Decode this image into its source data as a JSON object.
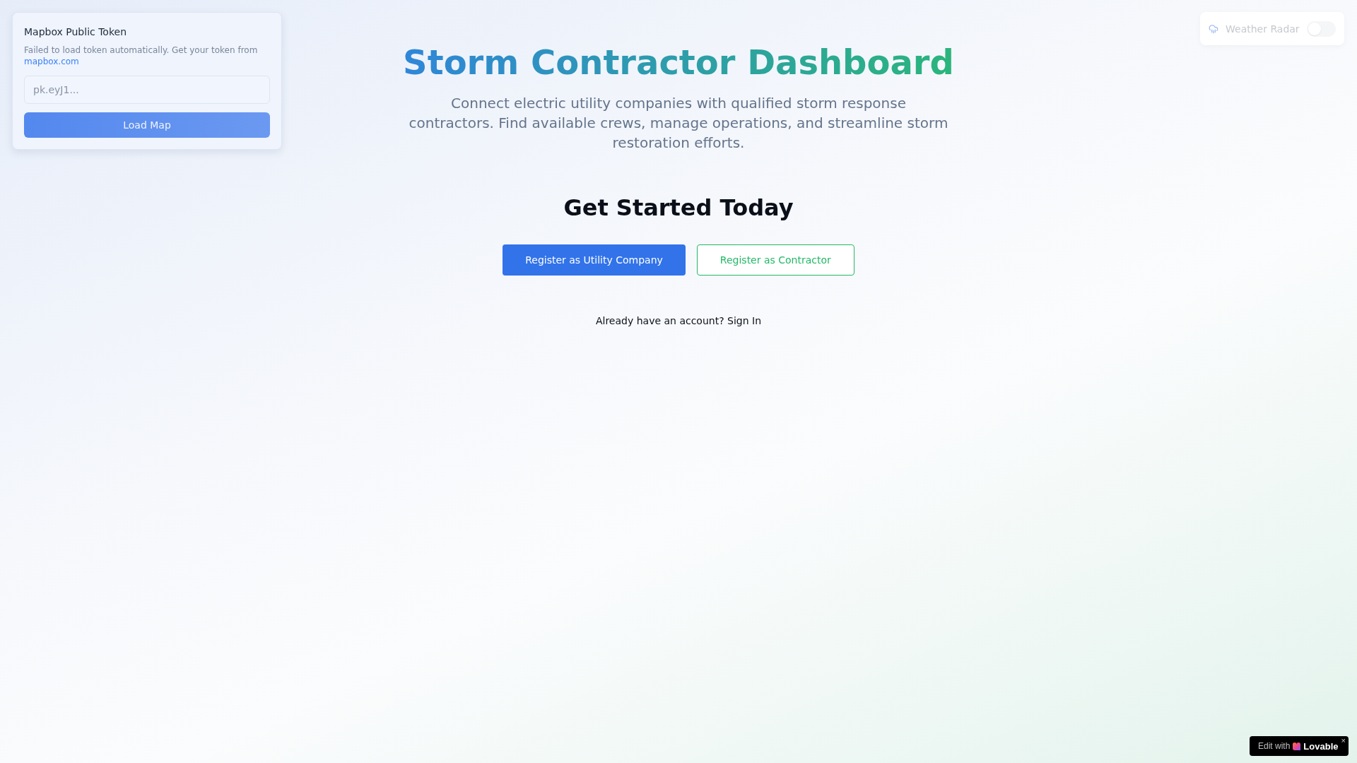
{
  "token_card": {
    "title": "Mapbox Public Token",
    "message": "Failed to load token automatically. Get your token from",
    "link": "mapbox.com",
    "input": {
      "placeholder": "pk.eyJ1..."
    },
    "button": "Load Map"
  },
  "weather_radar": {
    "label": "Weather Radar",
    "on": false
  },
  "hero": {
    "title": "Storm Contractor Dashboard",
    "subtitle": "Connect electric utility companies with qualified storm response contractors. Find available crews, manage operations, and streamline storm restoration efforts."
  },
  "get_started": {
    "heading": "Get Started Today",
    "buttons": [
      {
        "label": "Register as Utility Company",
        "kind": "primary"
      },
      {
        "label": "Register as Contractor",
        "kind": "outline"
      }
    ],
    "sign_in": "Already have an account? Sign In"
  },
  "badge": {
    "prefix": "Edit with",
    "brand": "Lovable",
    "close": "×"
  }
}
